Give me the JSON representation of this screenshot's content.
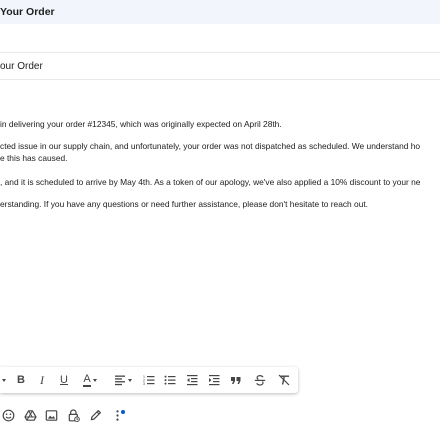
{
  "header": {
    "title": "Your Order"
  },
  "subject": {
    "value": "our Order"
  },
  "body": {
    "paragraphs": [
      "in delivering your order #12345, which was originally expected on April 28th.",
      "cted issue in our supply chain, and unfortunately, your order was not dispatched as scheduled. We understand ho",
      "e this has caused.",
      ", and it is scheduled to arrive by May 4th. As a token of our apology, we've also applied a 10% discount to your ne",
      "erstanding. If you have any questions or need further assistance, please don't hesitate to reach out."
    ]
  },
  "formatting_toolbar": {
    "bold_label": "B",
    "italic_label": "I",
    "underline_label": "U",
    "text_color_label": "A",
    "icons": [
      "dropdown-caret-icon",
      "bold-icon",
      "italic-icon",
      "underline-icon",
      "text-color-icon",
      "align-icon",
      "numbered-list-icon",
      "bulleted-list-icon",
      "indent-less-icon",
      "indent-more-icon",
      "quote-icon",
      "strikethrough-icon",
      "clear-formatting-icon"
    ]
  },
  "bottom_toolbar": {
    "icons": [
      "emoji-icon",
      "drive-icon",
      "insert-photo-icon",
      "confidential-mode-icon",
      "signature-icon",
      "more-options-icon"
    ]
  },
  "colors": {
    "header_bg": "#f2f6fc",
    "icon_gray": "#444746",
    "accent_blue": "#0b57d0"
  }
}
